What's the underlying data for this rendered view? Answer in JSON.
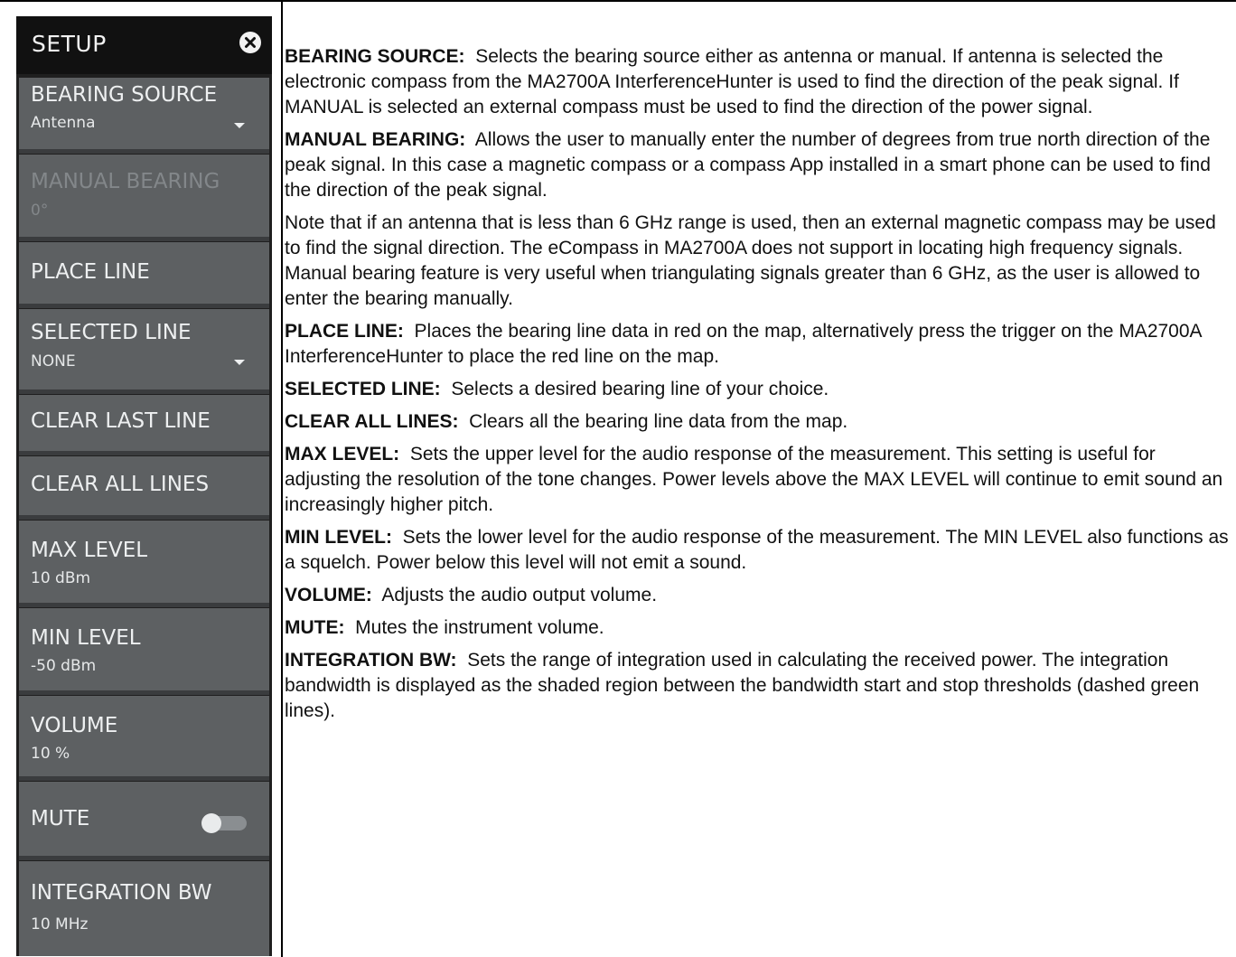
{
  "menu": {
    "title": "SETUP",
    "items": [
      {
        "label": "BEARING SOURCE",
        "value": "Antenna"
      },
      {
        "label": "MANUAL BEARING",
        "value": "0°"
      },
      {
        "label": "PLACE LINE"
      },
      {
        "label": "SELECTED LINE",
        "value": "NONE"
      },
      {
        "label": "CLEAR LAST LINE"
      },
      {
        "label": "CLEAR ALL LINES"
      },
      {
        "label": "MAX LEVEL",
        "value": "10 dBm"
      },
      {
        "label": "MIN LEVEL",
        "value": "-50 dBm"
      },
      {
        "label": "VOLUME",
        "value": "10 %"
      },
      {
        "label": "MUTE",
        "toggle_on": false
      },
      {
        "label": "INTEGRATION BW",
        "value": "10 MHz"
      }
    ]
  },
  "descriptions": [
    {
      "term": "BEARING SOURCE:",
      "text": "Selects the bearing source either as antenna or manual. If antenna is selected the electronic compass from the MA2700A InterferenceHunter is used to find the direction of the peak signal. If MANUAL is selected an external compass must be used to find the direction of the power signal."
    },
    {
      "term": "MANUAL BEARING:",
      "text": "Allows the user to manually enter the number of degrees from true north direction of the peak signal. In this case a magnetic compass or a compass App installed in a smart phone can be used to find the direction of the peak signal."
    },
    {
      "term": "",
      "text": "Note that if an antenna that is less than 6 GHz range is used, then an external magnetic compass may be used to find the signal direction. The eCompass in MA2700A does not support in locating high frequency signals. Manual bearing feature is very useful when triangulating signals greater than 6 GHz, as the user is allowed to enter the bearing manually."
    },
    {
      "term": "PLACE LINE:",
      "text": "Places the bearing line data in red on the map, alternatively press the trigger on the MA2700A InterferenceHunter to place the red line on the map."
    },
    {
      "term": "SELECTED LINE:",
      "text": "Selects a desired bearing line of your choice."
    },
    {
      "term": "CLEAR ALL LINES:",
      "text": "Clears all the bearing line data from the map."
    },
    {
      "term": "MAX LEVEL:",
      "text": "Sets the upper level for the audio response of the measurement. This setting is useful for adjusting the resolution of the tone changes. Power levels above the MAX LEVEL will continue to emit sound an increasingly higher pitch."
    },
    {
      "term": "MIN LEVEL:",
      "text": "Sets the lower level for the audio response of the measurement. The MIN LEVEL also functions as a squelch. Power below this level will not emit a sound."
    },
    {
      "term": "VOLUME:",
      "text": "Adjusts the audio output volume."
    },
    {
      "term": "MUTE:",
      "text": "Mutes the instrument volume."
    },
    {
      "term": "INTEGRATION BW:",
      "text": "Sets the range of integration used in calculating the received power. The integration bandwidth is displayed as the shaded region between the bandwidth start and stop thresholds (dashed green lines)."
    }
  ]
}
